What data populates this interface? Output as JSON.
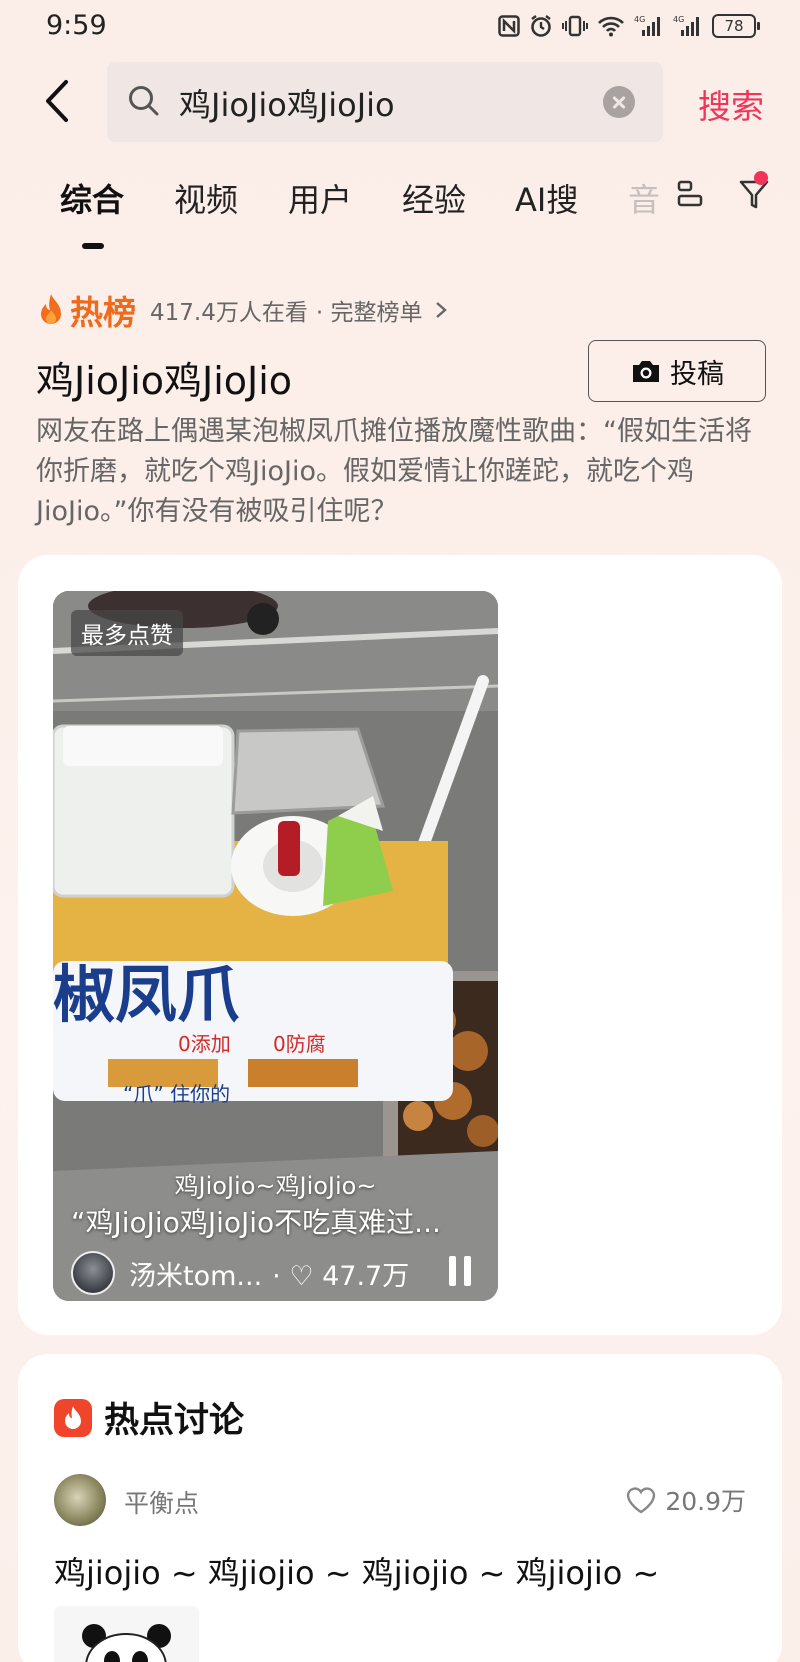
{
  "status_bar": {
    "time": "9:59",
    "battery": "78"
  },
  "search": {
    "query": "鸡JioJio鸡JioJio",
    "submit_label": "搜索"
  },
  "tabs": [
    "综合",
    "视频",
    "用户",
    "经验",
    "AI搜",
    "音"
  ],
  "hot": {
    "label": "热榜",
    "viewers": "417.4万人在看",
    "link": "· 完整榜单",
    "topic_title": "鸡JioJio鸡JioJio",
    "post_button": "投稿",
    "description": "网友在路上偶遇某泡椒凤爪摊位播放魔性歌曲：“假如生活将你折磨，就吃个鸡JioJio。假如爱情让你蹉跎，就吃个鸡JioJio。”你有没有被吸引住呢？"
  },
  "video_card": {
    "badge": "最多点赞",
    "caption": "鸡JioJio~鸡JioJio~",
    "title": "“鸡JioJio鸡JioJio不吃真难过...",
    "author": "汤米tom...",
    "likes": "· ♡ 47.7万",
    "sign_text": "椒凤爪",
    "sign_sub1": "0添加",
    "sign_sub2": "0防腐",
    "sign_bottom": "“爪” 住你的"
  },
  "discussion": {
    "title": "热点讨论",
    "user": "平衡点",
    "likes": "20.9万",
    "comment": "鸡jiojio ~ 鸡jiojio ~ 鸡jiojio ~ 鸡jiojio ~"
  },
  "colors": {
    "accent": "#f0345a",
    "hot": "#f06a1d"
  }
}
